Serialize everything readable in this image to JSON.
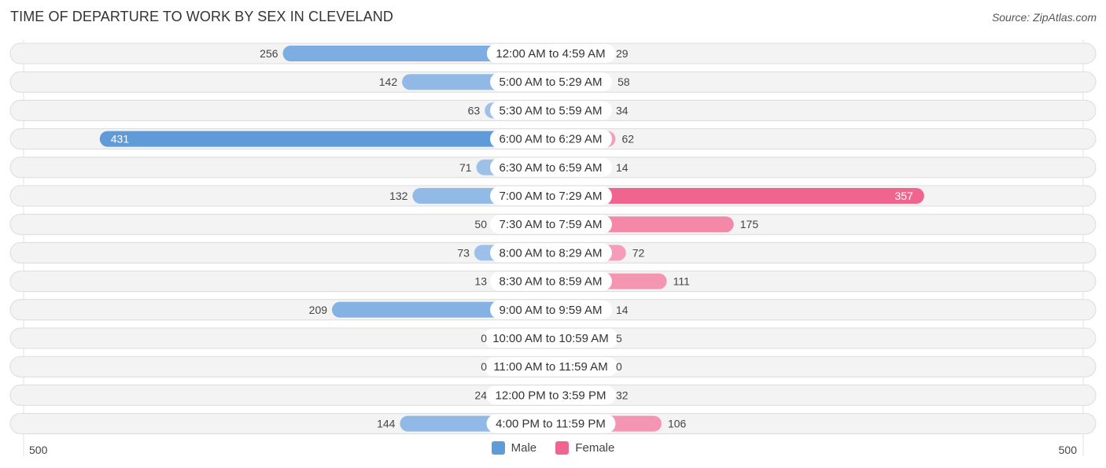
{
  "title": "TIME OF DEPARTURE TO WORK BY SEX IN CLEVELAND",
  "source": "Source: ZipAtlas.com",
  "colors": {
    "male_light": "#a9c8ec",
    "male_dark": "#5f9ad9",
    "female_light": "#f6aac2",
    "female_dark": "#f06590",
    "row_bg": "#f3f3f3",
    "row_border": "#dcdcdc"
  },
  "chart_data": {
    "type": "bar",
    "orientation": "horizontal-diverging",
    "title": "TIME OF DEPARTURE TO WORK BY SEX IN CLEVELAND",
    "categories": [
      "12:00 AM to 4:59 AM",
      "5:00 AM to 5:29 AM",
      "5:30 AM to 5:59 AM",
      "6:00 AM to 6:29 AM",
      "6:30 AM to 6:59 AM",
      "7:00 AM to 7:29 AM",
      "7:30 AM to 7:59 AM",
      "8:00 AM to 8:29 AM",
      "8:30 AM to 8:59 AM",
      "9:00 AM to 9:59 AM",
      "10:00 AM to 10:59 AM",
      "11:00 AM to 11:59 AM",
      "12:00 PM to 3:59 PM",
      "4:00 PM to 11:59 PM"
    ],
    "series": [
      {
        "name": "Male",
        "side": "left",
        "values": [
          256,
          142,
          63,
          431,
          71,
          132,
          50,
          73,
          13,
          209,
          0,
          0,
          24,
          144
        ]
      },
      {
        "name": "Female",
        "side": "right",
        "values": [
          29,
          58,
          34,
          62,
          14,
          357,
          175,
          72,
          111,
          14,
          5,
          0,
          32,
          106
        ]
      }
    ],
    "xlim": [
      500,
      500
    ],
    "axis_labels": {
      "left": "500",
      "right": "500"
    },
    "legend": {
      "position": "bottom-center",
      "entries": [
        "Male",
        "Female"
      ]
    },
    "grid": false
  }
}
